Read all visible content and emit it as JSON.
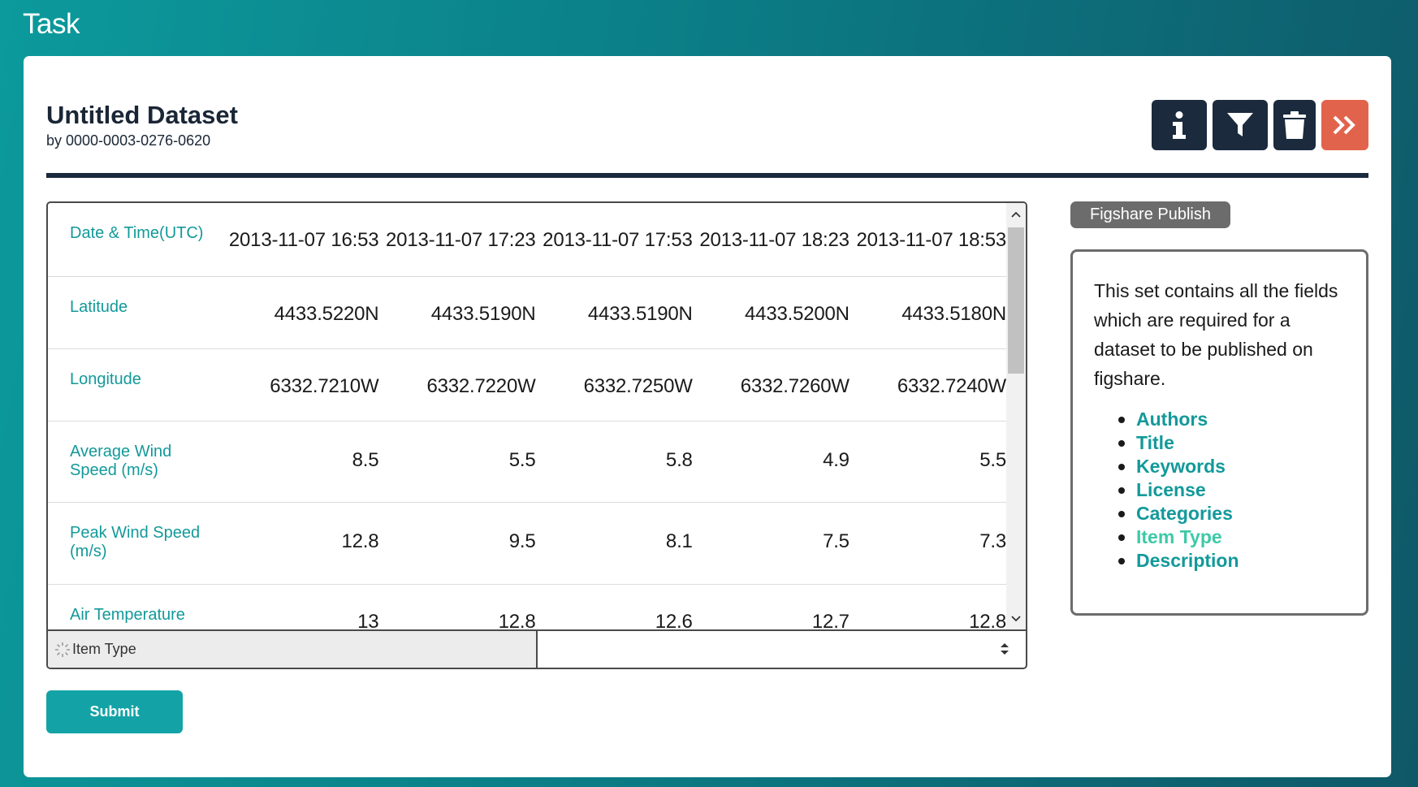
{
  "app": {
    "title": "Task"
  },
  "dataset": {
    "title": "Untitled Dataset",
    "byline": "by 0000-0003-0276-0620"
  },
  "toolbar": {
    "buttons": [
      {
        "name": "info-button",
        "icon": "info-icon"
      },
      {
        "name": "filter-button",
        "icon": "filter-icon"
      },
      {
        "name": "delete-button",
        "icon": "trash-icon"
      },
      {
        "name": "next-button",
        "icon": "double-chevron-right-icon"
      }
    ]
  },
  "table": {
    "rows": [
      {
        "label": "Date & Time(UTC)",
        "values": [
          "2013-11-07  16:53",
          "2013-11-07  17:23",
          "2013-11-07  17:53",
          "2013-11-07  18:23",
          "2013-11-07  18:53"
        ]
      },
      {
        "label": "Latitude",
        "values": [
          "4433.5220N",
          "4433.5190N",
          "4433.5190N",
          "4433.5200N",
          "4433.5180N"
        ]
      },
      {
        "label": "Longitude",
        "values": [
          "6332.7210W",
          "6332.7220W",
          "6332.7250W",
          "6332.7260W",
          "6332.7240W"
        ]
      },
      {
        "label": "Average Wind Speed (m/s)",
        "values": [
          "8.5",
          "5.5",
          "5.8",
          "4.9",
          "5.5"
        ]
      },
      {
        "label": "Peak Wind Speed (m/s)",
        "values": [
          "12.8",
          "9.5",
          "8.1",
          "7.5",
          "7.3"
        ]
      },
      {
        "label": "Air Temperature",
        "values": [
          "13",
          "12.8",
          "12.6",
          "12.7",
          "12.8"
        ]
      }
    ]
  },
  "item_type": {
    "label": "Item Type",
    "value": ""
  },
  "submit": {
    "label": "Submit"
  },
  "figshare": {
    "badge": "Figshare Publish",
    "description": "This set contains all the fields which are required for a dataset to be published on figshare.",
    "fields": [
      "Authors",
      "Title",
      "Keywords",
      "License",
      "Categories",
      "Item Type",
      "Description"
    ],
    "current_field": "Item Type"
  },
  "colors": {
    "accent": "#13999a",
    "dark": "#1b2a3d",
    "danger": "#e2634b",
    "current": "#3ec9a7"
  }
}
